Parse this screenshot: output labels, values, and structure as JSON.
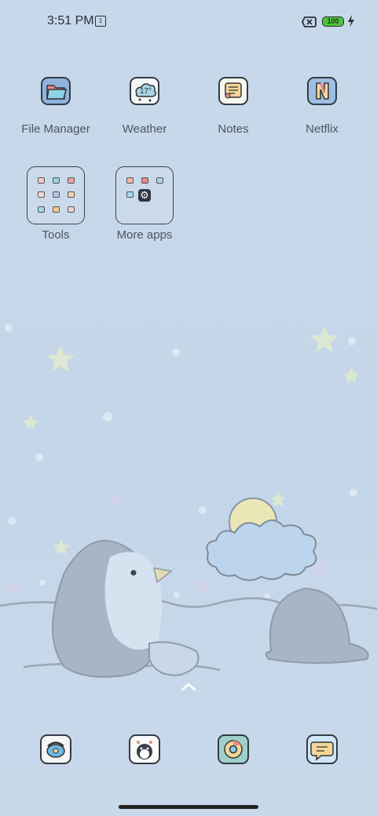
{
  "status_bar": {
    "time": "3:51 PM",
    "battery": "100"
  },
  "apps": [
    {
      "label": "File Manager",
      "icon": "file-manager-icon"
    },
    {
      "label": "Weather",
      "icon": "weather-icon",
      "icon_text": "17°"
    },
    {
      "label": "Notes",
      "icon": "notes-icon"
    },
    {
      "label": "Netflix",
      "icon": "netflix-icon"
    }
  ],
  "folders": [
    {
      "label": "Tools"
    },
    {
      "label": "More apps"
    }
  ],
  "dock": [
    {
      "icon": "phone-icon"
    },
    {
      "icon": "contacts-penguin-icon"
    },
    {
      "icon": "chrome-icon"
    },
    {
      "icon": "messages-icon"
    }
  ],
  "colors": {
    "battery": "#4fc23c",
    "wallpaper": "#c5d7ea"
  }
}
